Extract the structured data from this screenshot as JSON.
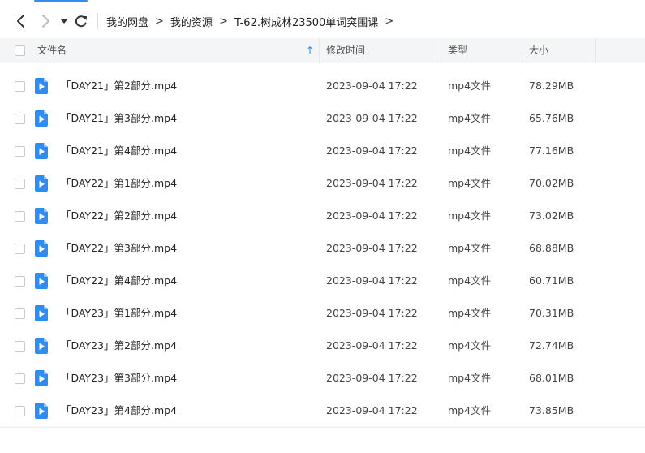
{
  "breadcrumb": [
    "我的网盘",
    "我的资源",
    "T-62.树成林23500单词突围课"
  ],
  "breadcrumb_separator": ">",
  "columns": {
    "name": "文件名",
    "modified": "修改时间",
    "type": "类型",
    "size": "大小"
  },
  "sort_indicator": "↑",
  "icons": {
    "back": "chevron-left-icon",
    "forward": "chevron-right-icon",
    "dropdown": "caret-down-icon",
    "refresh": "refresh-icon",
    "file": "video-file-icon"
  },
  "colors": {
    "accent": "#2f8cf0",
    "header_bg": "#f4f5f7",
    "file_icon": "#2f8cf0"
  },
  "files": [
    {
      "name": "「DAY21」第2部分.mp4",
      "modified": "2023-09-04 17:22",
      "type": "mp4文件",
      "size": "78.29MB"
    },
    {
      "name": "「DAY21」第3部分.mp4",
      "modified": "2023-09-04 17:22",
      "type": "mp4文件",
      "size": "65.76MB"
    },
    {
      "name": "「DAY21」第4部分.mp4",
      "modified": "2023-09-04 17:22",
      "type": "mp4文件",
      "size": "77.16MB"
    },
    {
      "name": "「DAY22」第1部分.mp4",
      "modified": "2023-09-04 17:22",
      "type": "mp4文件",
      "size": "70.02MB"
    },
    {
      "name": "「DAY22」第2部分.mp4",
      "modified": "2023-09-04 17:22",
      "type": "mp4文件",
      "size": "73.02MB"
    },
    {
      "name": "「DAY22」第3部分.mp4",
      "modified": "2023-09-04 17:22",
      "type": "mp4文件",
      "size": "68.88MB"
    },
    {
      "name": "「DAY22」第4部分.mp4",
      "modified": "2023-09-04 17:22",
      "type": "mp4文件",
      "size": "60.71MB"
    },
    {
      "name": "「DAY23」第1部分.mp4",
      "modified": "2023-09-04 17:22",
      "type": "mp4文件",
      "size": "70.31MB"
    },
    {
      "name": "「DAY23」第2部分.mp4",
      "modified": "2023-09-04 17:22",
      "type": "mp4文件",
      "size": "72.74MB"
    },
    {
      "name": "「DAY23」第3部分.mp4",
      "modified": "2023-09-04 17:22",
      "type": "mp4文件",
      "size": "68.01MB"
    },
    {
      "name": "「DAY23」第4部分.mp4",
      "modified": "2023-09-04 17:22",
      "type": "mp4文件",
      "size": "73.85MB"
    }
  ]
}
